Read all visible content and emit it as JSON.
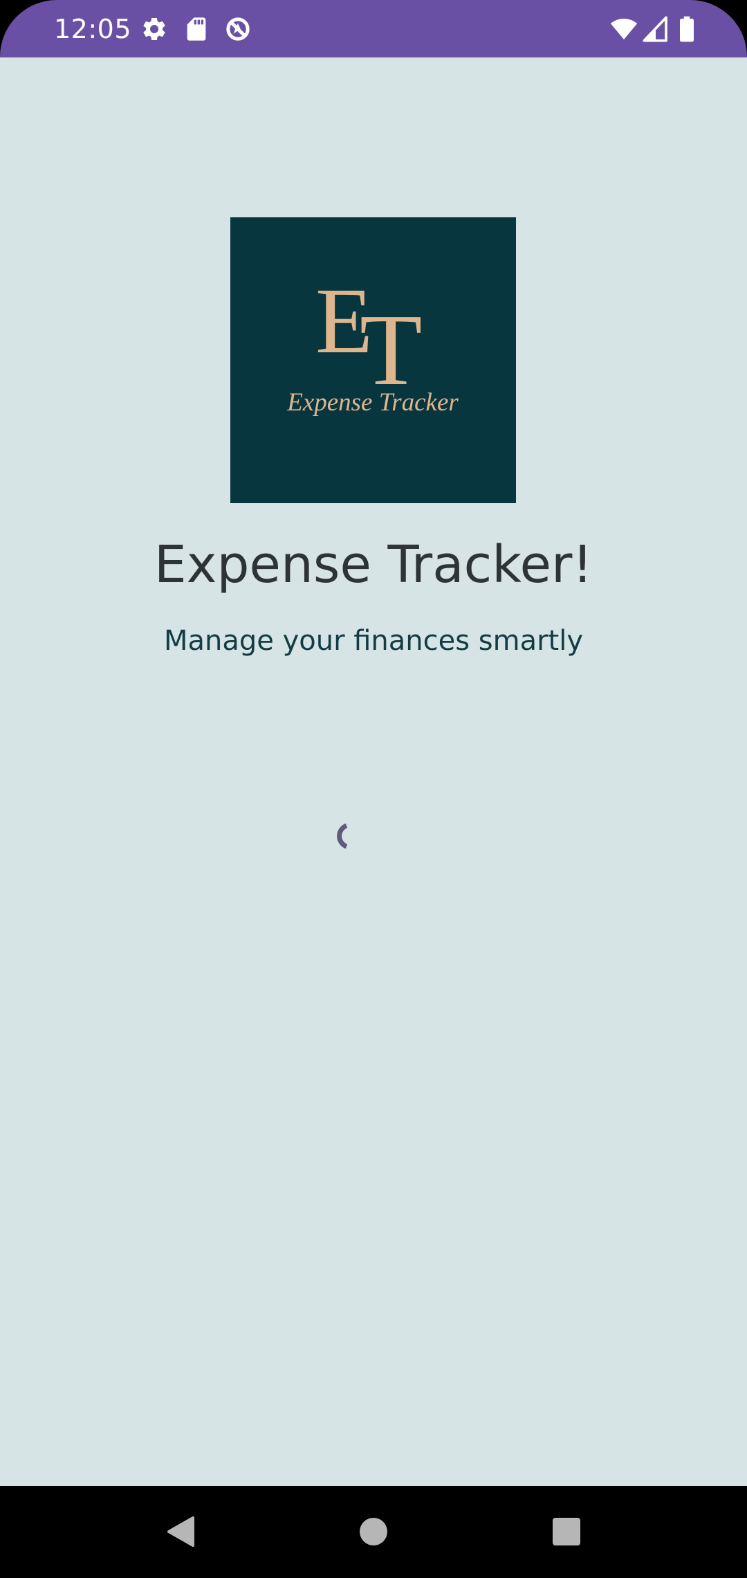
{
  "status_bar": {
    "time": "12:05",
    "left_icons": [
      "gear-icon",
      "sd-card-icon",
      "no-location-icon"
    ],
    "right_icons": [
      "wifi-icon",
      "cell-signal-icon",
      "battery-icon"
    ],
    "background_color": "#6a50a4"
  },
  "logo": {
    "monogram": "ET",
    "monogram_first": "E",
    "monogram_second": "T",
    "tagline": "Expense Tracker",
    "background_color": "#08363e",
    "accent_color": "#ddb68e"
  },
  "main": {
    "title": "Expense Tracker!",
    "subtitle": "Manage your finances smartly",
    "loading_indicator": "spinner-icon",
    "background_color": "#d7e4e6"
  },
  "nav_bar": {
    "buttons": [
      "back-icon",
      "home-icon",
      "recents-icon"
    ]
  }
}
